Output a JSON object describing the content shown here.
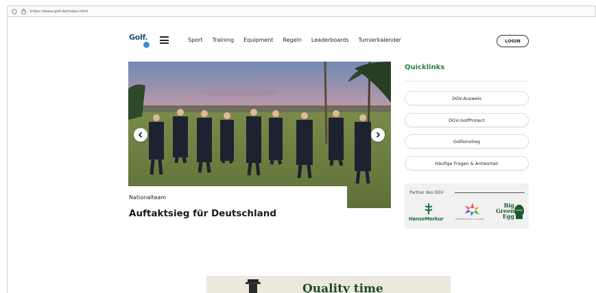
{
  "browser": {
    "url": "https://www.golf.de/index.html"
  },
  "header": {
    "logo_text": "Golf.",
    "nav": [
      "Sport",
      "Training",
      "Equipment",
      "Regeln",
      "Leaderboards",
      "Turnierkalender"
    ],
    "login_label": "LOGIN"
  },
  "hero": {
    "tag": "Nationalteam",
    "title": "Auftaktsieg für Deutschland"
  },
  "quicklinks": {
    "title": "Quicklinks",
    "items": [
      "DGV-Ausweis",
      "DGV-GolfProtect",
      "Golfeinstieg",
      "Häufige Fragen & Antworten"
    ]
  },
  "partners": {
    "label": "Partner des DGV",
    "hansemerkur": "HanseMerkur",
    "kinderhilfe": "KINDERSCHUTZ | ALLIANZ",
    "bge_line1": "Big",
    "bge_line2": "Green",
    "bge_line3": "Egg"
  },
  "ad": {
    "headline": "Quality time"
  },
  "colors": {
    "accent_green": "#2e7d3a",
    "logo_blue": "#1f4d7a"
  }
}
